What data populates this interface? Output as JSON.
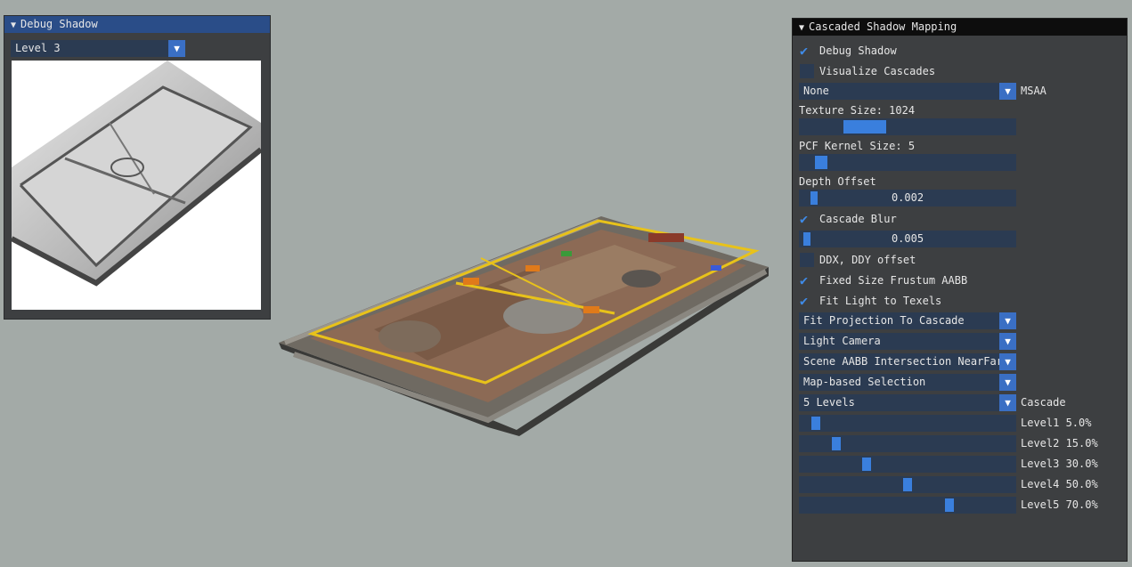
{
  "debug_window": {
    "title": "Debug Shadow",
    "level_select": "Level 3"
  },
  "csm_window": {
    "title": "Cascaded Shadow Mapping",
    "debug_shadow": {
      "label": "Debug Shadow",
      "checked": true
    },
    "visualize_cascades": {
      "label": "Visualize Cascades",
      "checked": false
    },
    "msaa": {
      "value": "None",
      "label": "MSAA"
    },
    "texture_size": {
      "label": "Texture Size: 1024",
      "level": 0.2
    },
    "pcf_kernel": {
      "label": "PCF Kernel Size: 5",
      "level": 0.02
    },
    "depth_offset": {
      "label": "Depth Offset",
      "value": "0.002",
      "level": 0.02
    },
    "cascade_blur": {
      "label": "Cascade Blur",
      "checked": true,
      "value": "0.005",
      "level": 0.005
    },
    "ddx_offset": {
      "label": "DDX, DDY offset",
      "checked": false
    },
    "fixed_size": {
      "label": "Fixed Size Frustum AABB",
      "checked": true
    },
    "fit_texels": {
      "label": "Fit Light to Texels",
      "checked": true
    },
    "fit_projection": "Fit Projection To Cascade",
    "camera": "Light Camera",
    "near_far": "Scene AABB Intersection NearFar",
    "selection": "Map-based Selection",
    "cascade": {
      "value": "5 Levels",
      "label": "Cascade"
    },
    "levels": [
      {
        "label": "Level1  5.0%",
        "percent": 5
      },
      {
        "label": "Level2  15.0%",
        "percent": 15
      },
      {
        "label": "Level3  30.0%",
        "percent": 30
      },
      {
        "label": "Level4  50.0%",
        "percent": 50
      },
      {
        "label": "Level5  70.0%",
        "percent": 70
      }
    ]
  },
  "icons": {
    "collapse": "triangle-down-icon",
    "dropdown": "arrow-down-icon",
    "check": "checkmark-icon"
  },
  "colors": {
    "background": "#a3aaa7",
    "window_bg": "#3d3f41",
    "active_title": "#2a4d88",
    "frame_bg": "#2b3b52",
    "accent": "#3a7fdd"
  }
}
